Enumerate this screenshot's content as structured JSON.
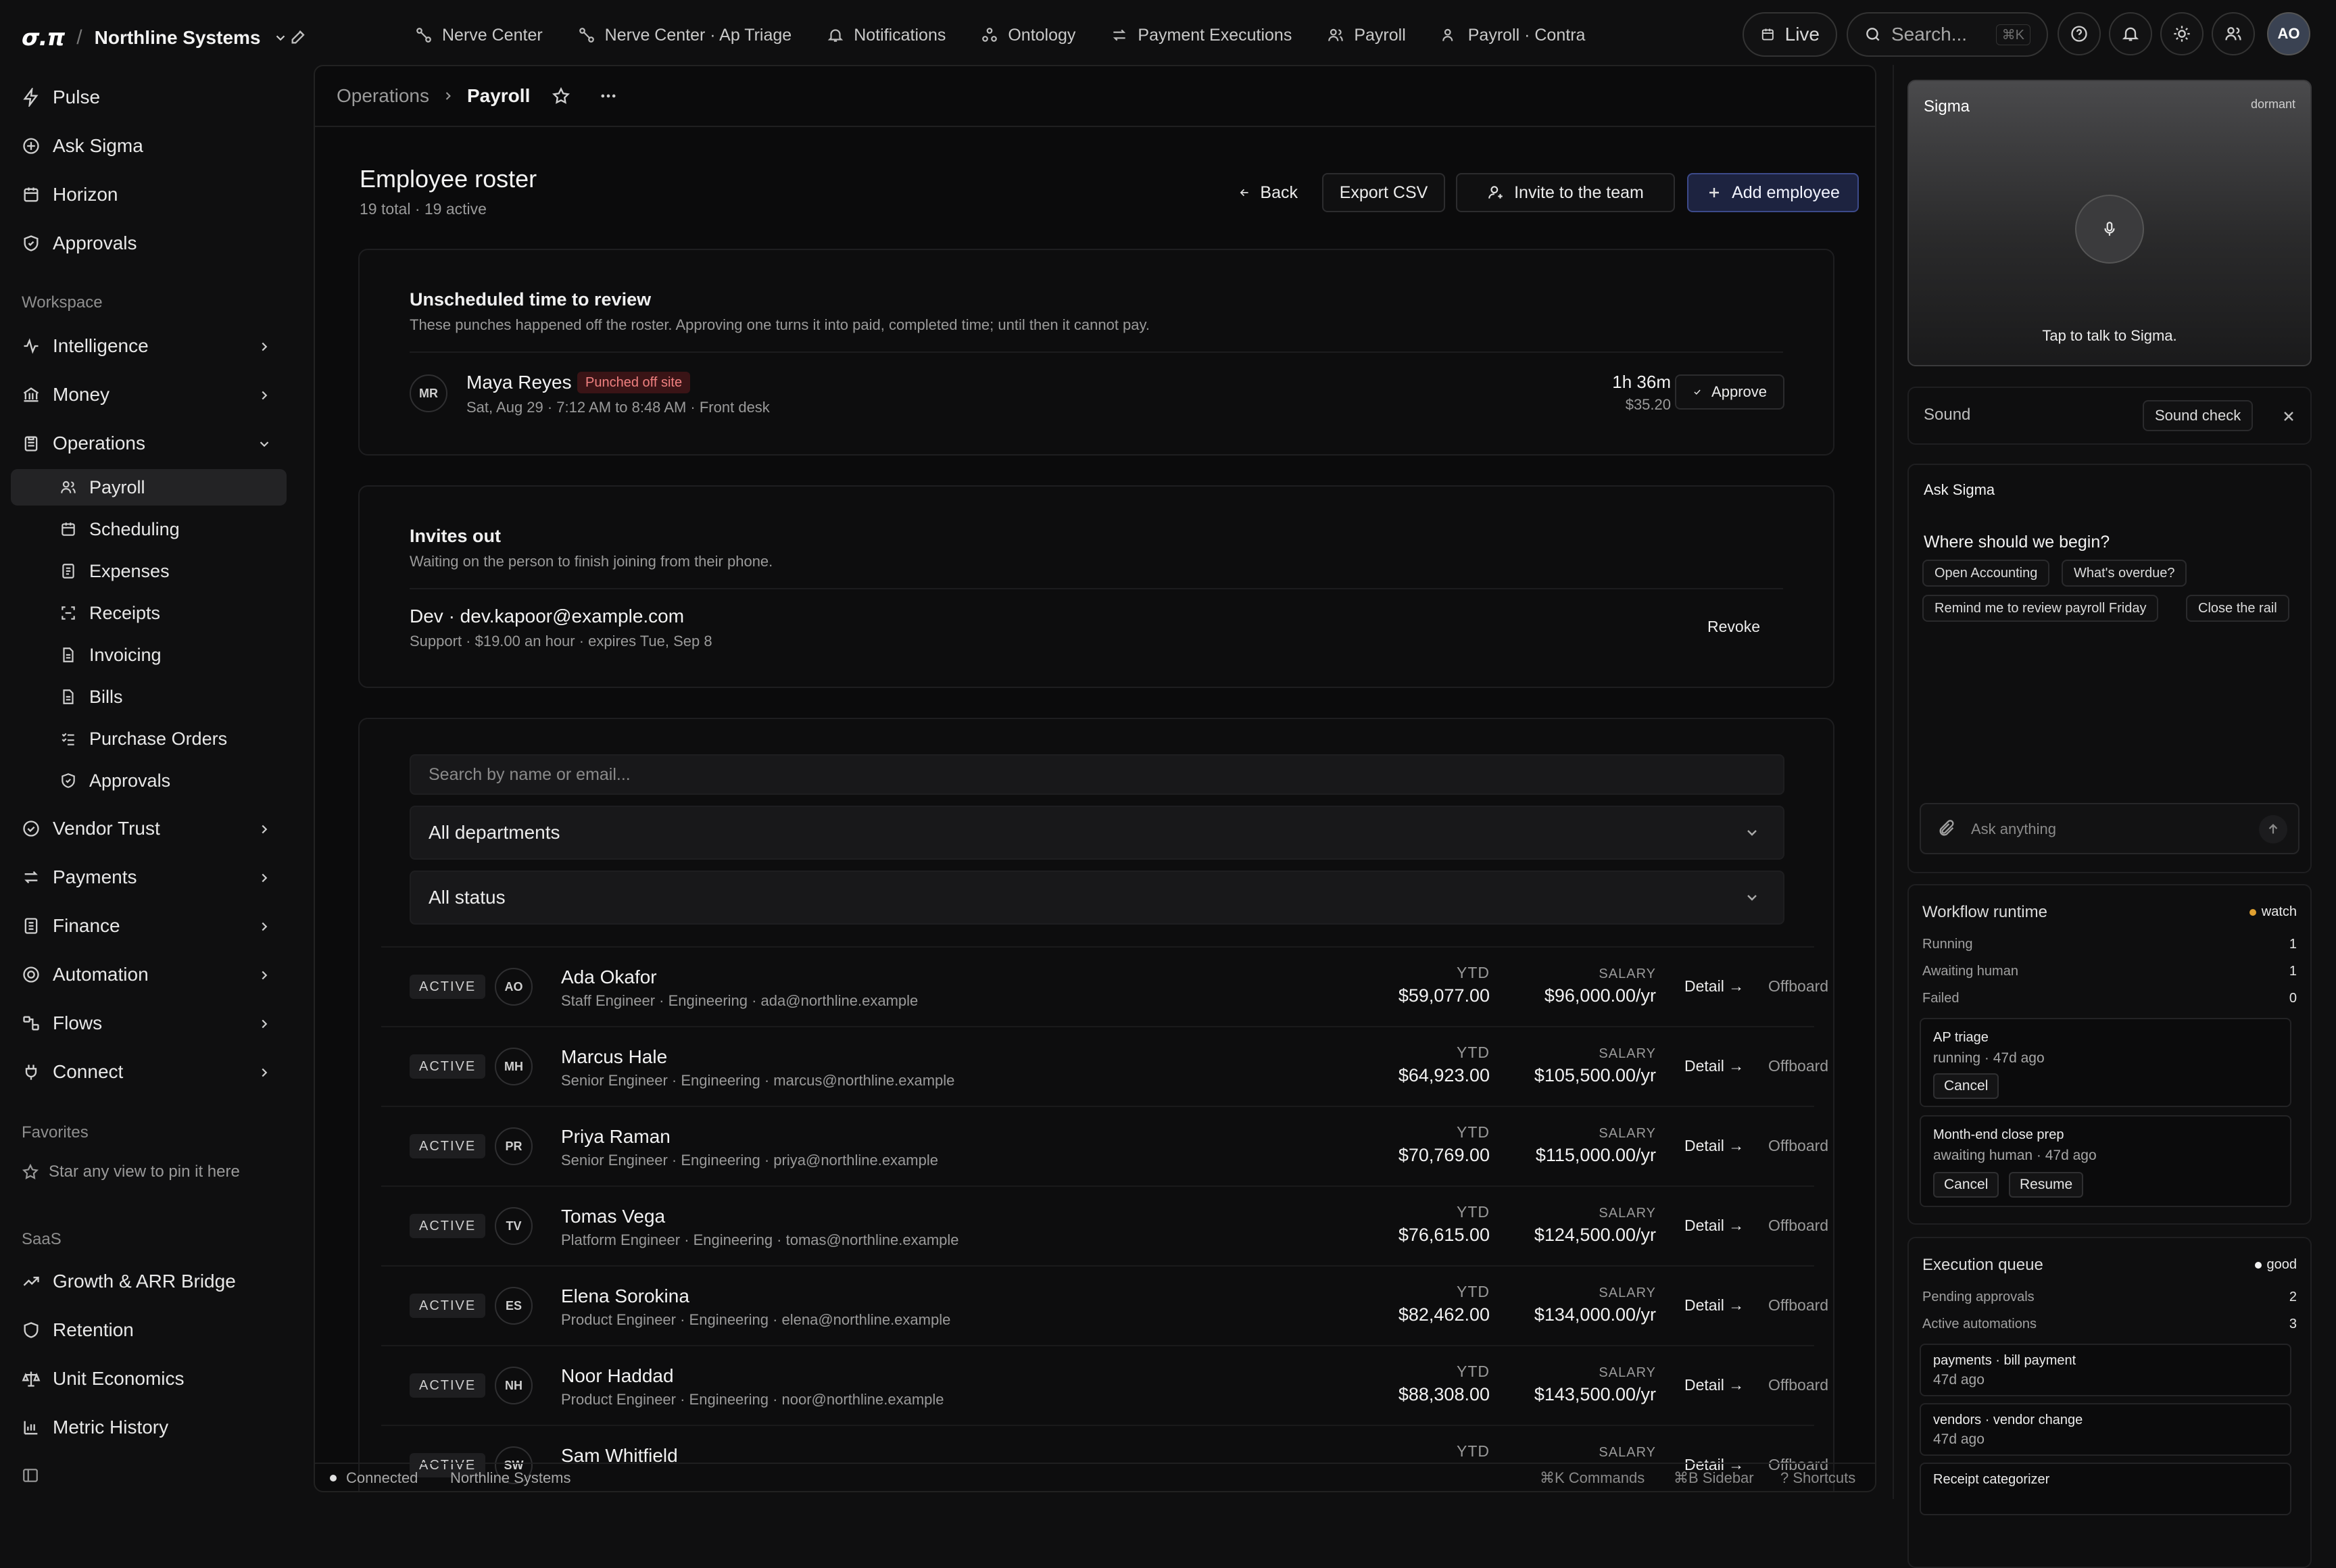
{
  "brand": {
    "logo": "σ.π",
    "org": "Northline Systems"
  },
  "top_tabs": [
    {
      "label": "Nerve Center",
      "icon": "nodes-icon"
    },
    {
      "label": "Nerve Center · Ap Triage",
      "icon": "nodes-icon"
    },
    {
      "label": "Notifications",
      "icon": "bell-icon"
    },
    {
      "label": "Ontology",
      "icon": "graph-icon"
    },
    {
      "label": "Payment Executions",
      "icon": "swap-icon"
    },
    {
      "label": "Payroll",
      "icon": "users-icon"
    },
    {
      "label": "Payroll · Contra",
      "icon": "users-icon"
    }
  ],
  "top_actions": {
    "live": "Live",
    "search_placeholder": "Search...",
    "search_kbd": "⌘K",
    "avatar": "AO"
  },
  "sidebar": {
    "top_items": [
      "Pulse",
      "Ask Sigma",
      "Horizon",
      "Approvals"
    ],
    "workspace_label": "Workspace",
    "workspace_items": [
      "Intelligence",
      "Money",
      "Operations"
    ],
    "operations_children": [
      "Payroll",
      "Scheduling",
      "Expenses",
      "Receipts",
      "Invoicing",
      "Bills",
      "Purchase Orders",
      "Approvals"
    ],
    "more_items": [
      "Vendor Trust",
      "Payments",
      "Finance",
      "Automation",
      "Flows",
      "Connect"
    ],
    "favorites_label": "Favorites",
    "favorites_hint": "Star any view to pin it here",
    "saas_label": "SaaS",
    "saas_items": [
      "Growth & ARR Bridge",
      "Retention",
      "Unit Economics",
      "Metric History"
    ]
  },
  "breadcrumb": {
    "parent": "Operations",
    "current": "Payroll"
  },
  "page": {
    "title": "Employee roster",
    "subtitle": "19 total · 19 active",
    "back": "Back",
    "export": "Export CSV",
    "invite": "Invite to the team",
    "add": "Add employee"
  },
  "unscheduled": {
    "title": "Unscheduled time to review",
    "desc": "These punches happened off the roster. Approving one turns it into paid, completed time; until then it cannot pay.",
    "item": {
      "initials": "MR",
      "name": "Maya Reyes",
      "badge": "Punched off site",
      "meta": "Sat, Aug 29 · 7:12 AM to 8:48 AM · Front desk",
      "duration": "1h 36m",
      "amount": "$35.20",
      "action": "Approve"
    }
  },
  "invites": {
    "title": "Invites out",
    "desc": "Waiting on the person to finish joining from their phone.",
    "item": {
      "name": "Dev · dev.kapoor@example.com",
      "meta": "Support · $19.00 an hour · expires Tue, Sep 8",
      "action": "Revoke"
    }
  },
  "filters": {
    "search_placeholder": "Search by name or email...",
    "department": "All departments",
    "status": "All status"
  },
  "roster_labels": {
    "ytd": "YTD",
    "salary": "SALARY",
    "detail": "Detail →",
    "offboard": "Offboard"
  },
  "employees": [
    {
      "status": "ACTIVE",
      "initials": "AO",
      "name": "Ada Okafor",
      "meta": "Staff Engineer · Engineering · ada@northline.example",
      "ytd": "$59,077.00",
      "salary": "$96,000.00/yr"
    },
    {
      "status": "ACTIVE",
      "initials": "MH",
      "name": "Marcus Hale",
      "meta": "Senior Engineer · Engineering · marcus@northline.example",
      "ytd": "$64,923.00",
      "salary": "$105,500.00/yr"
    },
    {
      "status": "ACTIVE",
      "initials": "PR",
      "name": "Priya Raman",
      "meta": "Senior Engineer · Engineering · priya@northline.example",
      "ytd": "$70,769.00",
      "salary": "$115,000.00/yr"
    },
    {
      "status": "ACTIVE",
      "initials": "TV",
      "name": "Tomas Vega",
      "meta": "Platform Engineer · Engineering · tomas@northline.example",
      "ytd": "$76,615.00",
      "salary": "$124,500.00/yr"
    },
    {
      "status": "ACTIVE",
      "initials": "ES",
      "name": "Elena Sorokina",
      "meta": "Product Engineer · Engineering · elena@northline.example",
      "ytd": "$82,462.00",
      "salary": "$134,000.00/yr"
    },
    {
      "status": "ACTIVE",
      "initials": "NH",
      "name": "Noor Haddad",
      "meta": "Product Engineer · Engineering · noor@northline.example",
      "ytd": "$88,308.00",
      "salary": "$143,500.00/yr"
    },
    {
      "status": "ACTIVE",
      "initials": "SW",
      "name": "Sam Whitfield",
      "meta": "",
      "ytd": "",
      "salary": ""
    }
  ],
  "footer": {
    "status": "Connected",
    "org": "Northline Systems",
    "cmd": "⌘K Commands",
    "sidebar": "⌘B Sidebar",
    "shortcuts": "? Shortcuts"
  },
  "sigma": {
    "title": "Sigma",
    "state": "dormant",
    "hint": "Tap to talk to Sigma."
  },
  "sound": {
    "label": "Sound",
    "check": "Sound check"
  },
  "ask": {
    "title": "Ask Sigma",
    "prompt": "Where should we begin?",
    "chips": [
      "Open Accounting",
      "What's overdue?",
      "Remind me to review payroll Friday",
      "Close the rail"
    ],
    "placeholder": "Ask anything"
  },
  "workflow": {
    "title": "Workflow runtime",
    "badge": "watch",
    "badge_color": "#e0a030",
    "stats": [
      {
        "label": "Running",
        "value": "1"
      },
      {
        "label": "Awaiting human",
        "value": "1"
      },
      {
        "label": "Failed",
        "value": "0"
      }
    ],
    "tasks": [
      {
        "name": "AP triage",
        "state": "running · 47d ago",
        "actions": [
          "Cancel"
        ]
      },
      {
        "name": "Month-end close prep",
        "state": "awaiting human · 47d ago",
        "actions": [
          "Cancel",
          "Resume"
        ]
      }
    ]
  },
  "queue": {
    "title": "Execution queue",
    "badge": "good",
    "badge_color": "#f2f2f2",
    "stats": [
      {
        "label": "Pending approvals",
        "value": "2"
      },
      {
        "label": "Active automations",
        "value": "3"
      }
    ],
    "items": [
      {
        "name": "payments · bill payment",
        "time": "47d ago"
      },
      {
        "name": "vendors · vendor change",
        "time": "47d ago"
      },
      {
        "name": "Receipt categorizer",
        "time": ""
      }
    ]
  }
}
